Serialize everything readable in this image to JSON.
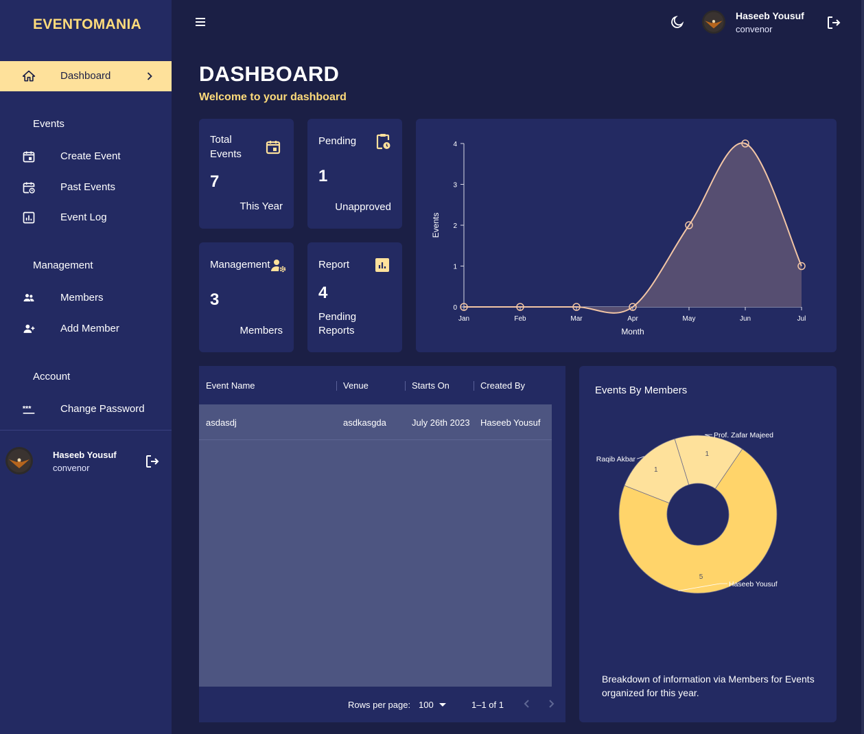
{
  "app": {
    "brand": "EVENTOMANIA"
  },
  "sidebar": {
    "active": {
      "label": "Dashboard"
    },
    "sections": [
      {
        "title": "Events",
        "items": [
          {
            "label": "Create Event",
            "icon": "calendar-add-icon"
          },
          {
            "label": "Past Events",
            "icon": "calendar-history-icon"
          },
          {
            "label": "Event Log",
            "icon": "chart-box-icon"
          }
        ]
      },
      {
        "title": "Management",
        "items": [
          {
            "label": "Members",
            "icon": "people-icon"
          },
          {
            "label": "Add Member",
            "icon": "person-add-icon"
          }
        ]
      },
      {
        "title": "Account",
        "items": [
          {
            "label": "Change Password",
            "icon": "password-icon"
          }
        ]
      }
    ],
    "user": {
      "name": "Haseeb Yousuf",
      "role": "convenor"
    }
  },
  "topbar": {
    "user": {
      "name": "Haseeb Yousuf",
      "role": "convenor"
    }
  },
  "page": {
    "title": "DASHBOARD",
    "subtitle": "Welcome to your dashboard"
  },
  "stats": [
    {
      "label": "Total Events",
      "value": "7",
      "caption": "This Year",
      "icon": "calendar-icon"
    },
    {
      "label": "Pending",
      "value": "1",
      "caption": "Unapproved",
      "icon": "clipboard-clock-icon"
    },
    {
      "label": "Management",
      "value": "3",
      "caption": "Members",
      "icon": "person-gear-icon"
    },
    {
      "label": "Report",
      "value": "4",
      "caption": "Pending Reports",
      "icon": "bar-chart-icon"
    }
  ],
  "chart_data": [
    {
      "type": "area",
      "categories": [
        "Jan",
        "Feb",
        "Mar",
        "Apr",
        "May",
        "Jun",
        "Jul"
      ],
      "values": [
        0,
        0,
        0,
        0,
        2,
        4,
        1
      ],
      "xlabel": "Month",
      "ylabel": "Events",
      "ylim": [
        0,
        4
      ],
      "yticks": [
        0,
        1,
        2,
        3,
        4
      ],
      "grid": false,
      "colors": {
        "line": "#f3c6a5",
        "fill": "#564e71"
      }
    },
    {
      "type": "pie",
      "title": "Events By Members",
      "variant": "donut",
      "slices": [
        {
          "label": "Prof. Zafar Majeed",
          "value": 1,
          "color": "#fee19b"
        },
        {
          "label": "Haseeb Yousuf",
          "value": 5,
          "color": "#ffd46a"
        },
        {
          "label": "Raqib Akbar",
          "value": 1,
          "color": "#fee19b"
        }
      ]
    }
  ],
  "pie_card": {
    "title": "Events By Members",
    "description": "Breakdown of information via Members for Events organized for this year."
  },
  "table": {
    "columns": [
      "Event Name",
      "Venue",
      "Starts On",
      "Created By"
    ],
    "rows": [
      [
        "asdasdj",
        "asdkasgda",
        "July 26th 2023",
        "Haseeb Yousuf"
      ]
    ],
    "rows_per_page_label": "Rows per page:",
    "rows_per_page": "100",
    "range": "1–1 of 1"
  },
  "colors": {
    "background": "#1b1f45",
    "panel": "#232a62",
    "accent": "#fedb7b",
    "active_nav": "#fee19b",
    "table_body": "#4d5581"
  }
}
